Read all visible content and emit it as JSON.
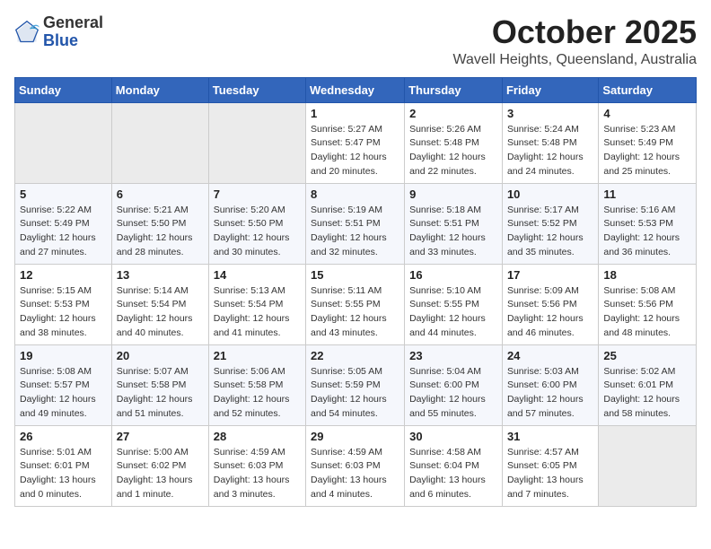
{
  "header": {
    "logo_general": "General",
    "logo_blue": "Blue",
    "month_title": "October 2025",
    "location": "Wavell Heights, Queensland, Australia"
  },
  "weekdays": [
    "Sunday",
    "Monday",
    "Tuesday",
    "Wednesday",
    "Thursday",
    "Friday",
    "Saturday"
  ],
  "weeks": [
    [
      {
        "day": "",
        "info": ""
      },
      {
        "day": "",
        "info": ""
      },
      {
        "day": "",
        "info": ""
      },
      {
        "day": "1",
        "info": "Sunrise: 5:27 AM\nSunset: 5:47 PM\nDaylight: 12 hours\nand 20 minutes."
      },
      {
        "day": "2",
        "info": "Sunrise: 5:26 AM\nSunset: 5:48 PM\nDaylight: 12 hours\nand 22 minutes."
      },
      {
        "day": "3",
        "info": "Sunrise: 5:24 AM\nSunset: 5:48 PM\nDaylight: 12 hours\nand 24 minutes."
      },
      {
        "day": "4",
        "info": "Sunrise: 5:23 AM\nSunset: 5:49 PM\nDaylight: 12 hours\nand 25 minutes."
      }
    ],
    [
      {
        "day": "5",
        "info": "Sunrise: 5:22 AM\nSunset: 5:49 PM\nDaylight: 12 hours\nand 27 minutes."
      },
      {
        "day": "6",
        "info": "Sunrise: 5:21 AM\nSunset: 5:50 PM\nDaylight: 12 hours\nand 28 minutes."
      },
      {
        "day": "7",
        "info": "Sunrise: 5:20 AM\nSunset: 5:50 PM\nDaylight: 12 hours\nand 30 minutes."
      },
      {
        "day": "8",
        "info": "Sunrise: 5:19 AM\nSunset: 5:51 PM\nDaylight: 12 hours\nand 32 minutes."
      },
      {
        "day": "9",
        "info": "Sunrise: 5:18 AM\nSunset: 5:51 PM\nDaylight: 12 hours\nand 33 minutes."
      },
      {
        "day": "10",
        "info": "Sunrise: 5:17 AM\nSunset: 5:52 PM\nDaylight: 12 hours\nand 35 minutes."
      },
      {
        "day": "11",
        "info": "Sunrise: 5:16 AM\nSunset: 5:53 PM\nDaylight: 12 hours\nand 36 minutes."
      }
    ],
    [
      {
        "day": "12",
        "info": "Sunrise: 5:15 AM\nSunset: 5:53 PM\nDaylight: 12 hours\nand 38 minutes."
      },
      {
        "day": "13",
        "info": "Sunrise: 5:14 AM\nSunset: 5:54 PM\nDaylight: 12 hours\nand 40 minutes."
      },
      {
        "day": "14",
        "info": "Sunrise: 5:13 AM\nSunset: 5:54 PM\nDaylight: 12 hours\nand 41 minutes."
      },
      {
        "day": "15",
        "info": "Sunrise: 5:11 AM\nSunset: 5:55 PM\nDaylight: 12 hours\nand 43 minutes."
      },
      {
        "day": "16",
        "info": "Sunrise: 5:10 AM\nSunset: 5:55 PM\nDaylight: 12 hours\nand 44 minutes."
      },
      {
        "day": "17",
        "info": "Sunrise: 5:09 AM\nSunset: 5:56 PM\nDaylight: 12 hours\nand 46 minutes."
      },
      {
        "day": "18",
        "info": "Sunrise: 5:08 AM\nSunset: 5:56 PM\nDaylight: 12 hours\nand 48 minutes."
      }
    ],
    [
      {
        "day": "19",
        "info": "Sunrise: 5:08 AM\nSunset: 5:57 PM\nDaylight: 12 hours\nand 49 minutes."
      },
      {
        "day": "20",
        "info": "Sunrise: 5:07 AM\nSunset: 5:58 PM\nDaylight: 12 hours\nand 51 minutes."
      },
      {
        "day": "21",
        "info": "Sunrise: 5:06 AM\nSunset: 5:58 PM\nDaylight: 12 hours\nand 52 minutes."
      },
      {
        "day": "22",
        "info": "Sunrise: 5:05 AM\nSunset: 5:59 PM\nDaylight: 12 hours\nand 54 minutes."
      },
      {
        "day": "23",
        "info": "Sunrise: 5:04 AM\nSunset: 6:00 PM\nDaylight: 12 hours\nand 55 minutes."
      },
      {
        "day": "24",
        "info": "Sunrise: 5:03 AM\nSunset: 6:00 PM\nDaylight: 12 hours\nand 57 minutes."
      },
      {
        "day": "25",
        "info": "Sunrise: 5:02 AM\nSunset: 6:01 PM\nDaylight: 12 hours\nand 58 minutes."
      }
    ],
    [
      {
        "day": "26",
        "info": "Sunrise: 5:01 AM\nSunset: 6:01 PM\nDaylight: 13 hours\nand 0 minutes."
      },
      {
        "day": "27",
        "info": "Sunrise: 5:00 AM\nSunset: 6:02 PM\nDaylight: 13 hours\nand 1 minute."
      },
      {
        "day": "28",
        "info": "Sunrise: 4:59 AM\nSunset: 6:03 PM\nDaylight: 13 hours\nand 3 minutes."
      },
      {
        "day": "29",
        "info": "Sunrise: 4:59 AM\nSunset: 6:03 PM\nDaylight: 13 hours\nand 4 minutes."
      },
      {
        "day": "30",
        "info": "Sunrise: 4:58 AM\nSunset: 6:04 PM\nDaylight: 13 hours\nand 6 minutes."
      },
      {
        "day": "31",
        "info": "Sunrise: 4:57 AM\nSunset: 6:05 PM\nDaylight: 13 hours\nand 7 minutes."
      },
      {
        "day": "",
        "info": ""
      }
    ]
  ]
}
